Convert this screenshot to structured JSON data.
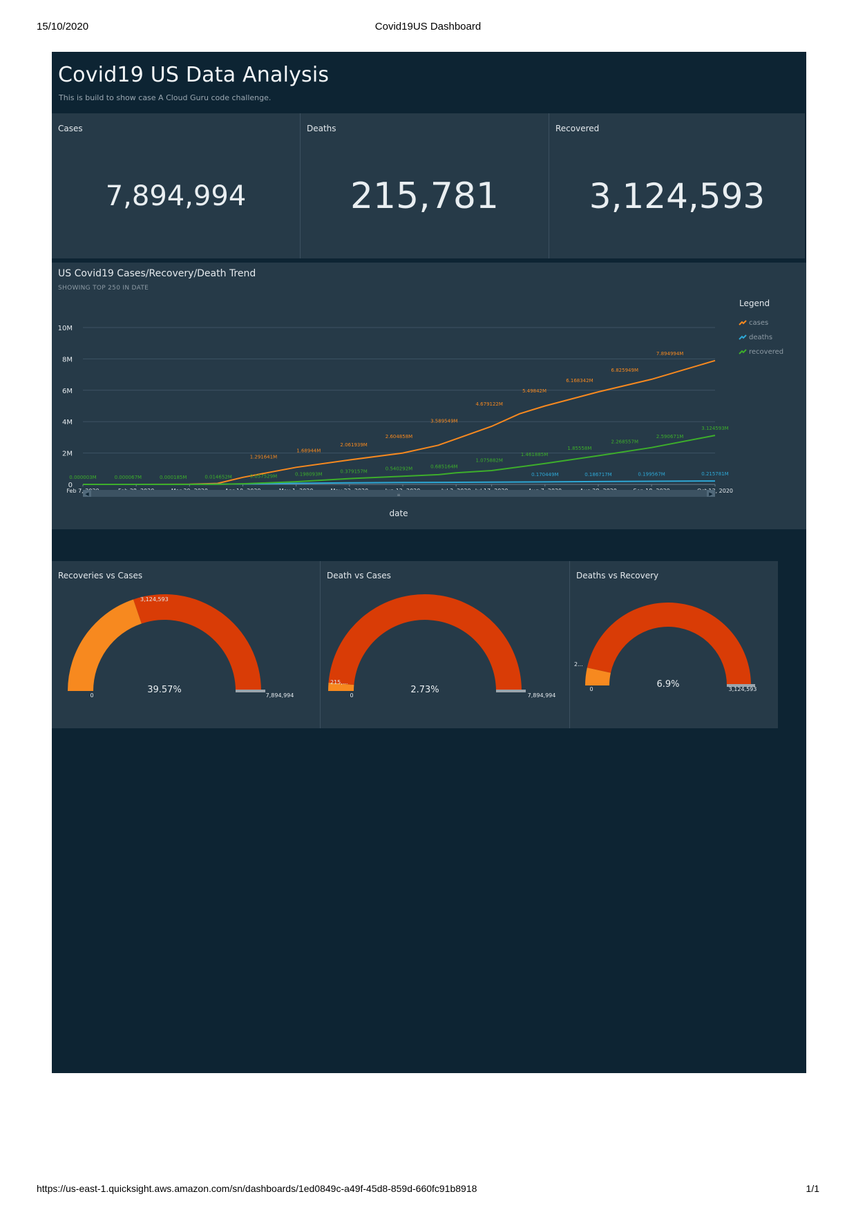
{
  "print": {
    "date": "15/10/2020",
    "title": "Covid19US Dashboard",
    "url": "https://us-east-1.quicksight.aws.amazon.com/sn/dashboards/1ed0849c-a49f-45d8-859d-660fc91b8918",
    "page": "1/1"
  },
  "dashboard": {
    "title": "Covid19 US Data Analysis",
    "description": "This is build to show case A Cloud Guru code challenge."
  },
  "kpis": [
    {
      "label": "Cases",
      "value": "7,894,994"
    },
    {
      "label": "Deaths",
      "value": "215,781"
    },
    {
      "label": "Recovered",
      "value": "3,124,593"
    }
  ],
  "trend": {
    "title": "US Covid19 Cases/Recovery/Death Trend",
    "subtitle": "SHOWING TOP 250 IN DATE",
    "legend_title": "Legend"
  },
  "gauges": [
    {
      "label": "Recoveries vs Cases",
      "value_label": "3,124,593",
      "percent": "39.57%",
      "min_label": "0",
      "max_label": "7,894,994",
      "fraction": 0.3957
    },
    {
      "label": "Death vs Cases",
      "value_label": "215,...",
      "percent": "2.73%",
      "min_label": "0",
      "max_label": "7,894,994",
      "fraction": 0.0273
    },
    {
      "label": "Deaths vs Recovery",
      "value_label": "2...",
      "percent": "6.9%",
      "min_label": "0",
      "max_label": "3,124,593",
      "fraction": 0.069
    }
  ],
  "colors": {
    "cases": "#f7891f",
    "deaths": "#2ea8d6",
    "recovered": "#3dae2b",
    "gauge_fill": "#d93c06",
    "gauge_value": "#f7891f",
    "background": "#0d2433",
    "panel": "#263a48"
  },
  "chart_data": {
    "type": "line",
    "xlabel": "date",
    "ylabel": "",
    "ylim": [
      0,
      10000000
    ],
    "y_ticks": [
      "0",
      "2M",
      "4M",
      "6M",
      "8M",
      "10M"
    ],
    "x_tick_labels": [
      "Feb 7, 2020",
      "Feb 28, 2020",
      "Mar 20, 2020",
      "Apr 10, 2020",
      "May 1, 2020",
      "May 22, 2020",
      "Jun 12, 2020",
      "Jul 3, 2020",
      "Jul 17, 2020",
      "Aug 7, 2020",
      "Aug 28, 2020",
      "Sep 18, 2020",
      "Oct 13, 2020"
    ],
    "x_tick_pos": [
      0,
      21,
      42,
      63,
      84,
      105,
      126,
      147,
      161,
      182,
      203,
      224,
      249
    ],
    "grid": true,
    "legend_position": "right",
    "series": [
      {
        "name": "cases",
        "points": [
          [
            0,
            0
          ],
          [
            21,
            15
          ],
          [
            42,
            10000
          ],
          [
            53,
            60000
          ],
          [
            63,
            450000
          ],
          [
            84,
            1090000
          ],
          [
            105,
            1560000
          ],
          [
            126,
            2000000
          ],
          [
            140,
            2500000
          ],
          [
            147,
            2900000
          ],
          [
            161,
            3700000
          ],
          [
            172,
            4500000
          ],
          [
            182,
            5000000
          ],
          [
            203,
            5900000
          ],
          [
            224,
            6700000
          ],
          [
            249,
            7894994
          ]
        ],
        "labels": [
          {
            "i": 84,
            "v": 1291641,
            "text": "1.291641M"
          },
          {
            "i": 105,
            "v": 1689440,
            "text": "1.68944M"
          },
          {
            "i": 126,
            "v": 2061939,
            "text": "2.061939M"
          },
          {
            "i": 147,
            "v": 2604858,
            "text": "2.604858M"
          },
          {
            "i": 168,
            "v": 3589549,
            "text": "3.589549M"
          },
          {
            "i": 189,
            "v": 4679122,
            "text": "4.679122M"
          },
          {
            "i": 210,
            "v": 5498420,
            "text": "5.49842M"
          },
          {
            "i": 231,
            "v": 6168342,
            "text": "6.168342M"
          },
          {
            "i": 252,
            "v": 6825949,
            "text": "6.825949M"
          },
          {
            "i": 273,
            "v": 7894994,
            "text": "7.894994M"
          }
        ]
      },
      {
        "name": "deaths",
        "points": [
          [
            0,
            0
          ],
          [
            42,
            2000
          ],
          [
            63,
            25000
          ],
          [
            84,
            65000
          ],
          [
            105,
            97000
          ],
          [
            126,
            117000
          ],
          [
            147,
            131000
          ],
          [
            161,
            140000
          ],
          [
            182,
            160000
          ],
          [
            203,
            180000
          ],
          [
            224,
            198000
          ],
          [
            249,
            215781
          ]
        ],
        "labels": [
          {
            "i": 182,
            "v": 170449,
            "text": "0.170449M"
          },
          {
            "i": 203,
            "v": 186717,
            "text": "0.186717M"
          },
          {
            "i": 224,
            "v": 199567,
            "text": "0.199567M"
          },
          {
            "i": 249,
            "v": 215781,
            "text": "0.215781M"
          }
        ]
      },
      {
        "name": "recovered",
        "points": [
          [
            0,
            0
          ],
          [
            42,
            300
          ],
          [
            53,
            4000
          ],
          [
            63,
            40000
          ],
          [
            84,
            170000
          ],
          [
            105,
            370000
          ],
          [
            126,
            520000
          ],
          [
            140,
            620000
          ],
          [
            147,
            740000
          ],
          [
            161,
            880000
          ],
          [
            182,
            1330000
          ],
          [
            203,
            1830000
          ],
          [
            224,
            2350000
          ],
          [
            249,
            3124593
          ]
        ],
        "labels": [
          {
            "i": 0,
            "v": 3,
            "text": "0.000003M"
          },
          {
            "i": 21,
            "v": 67,
            "text": "0.000067M"
          },
          {
            "i": 42,
            "v": 185,
            "text": "0.000185M"
          },
          {
            "i": 63,
            "v": 14652,
            "text": "0.014652M"
          },
          {
            "i": 84,
            "v": 57529,
            "text": "0.057529M"
          },
          {
            "i": 105,
            "v": 198093,
            "text": "0.198093M"
          },
          {
            "i": 126,
            "v": 379157,
            "text": "0.379157M"
          },
          {
            "i": 147,
            "v": 540292,
            "text": "0.540292M"
          },
          {
            "i": 168,
            "v": 685164,
            "text": "0.685164M"
          },
          {
            "i": 189,
            "v": 1075882,
            "text": "1.075882M"
          },
          {
            "i": 210,
            "v": 1461885,
            "text": "1.461885M"
          },
          {
            "i": 231,
            "v": 1855580,
            "text": "1.85558M"
          },
          {
            "i": 252,
            "v": 2268557,
            "text": "2.268557M"
          },
          {
            "i": 273,
            "v": 2590671,
            "text": "2.590671M"
          },
          {
            "i": 294,
            "v": 3124593,
            "text": "3.124593M"
          }
        ]
      }
    ]
  }
}
